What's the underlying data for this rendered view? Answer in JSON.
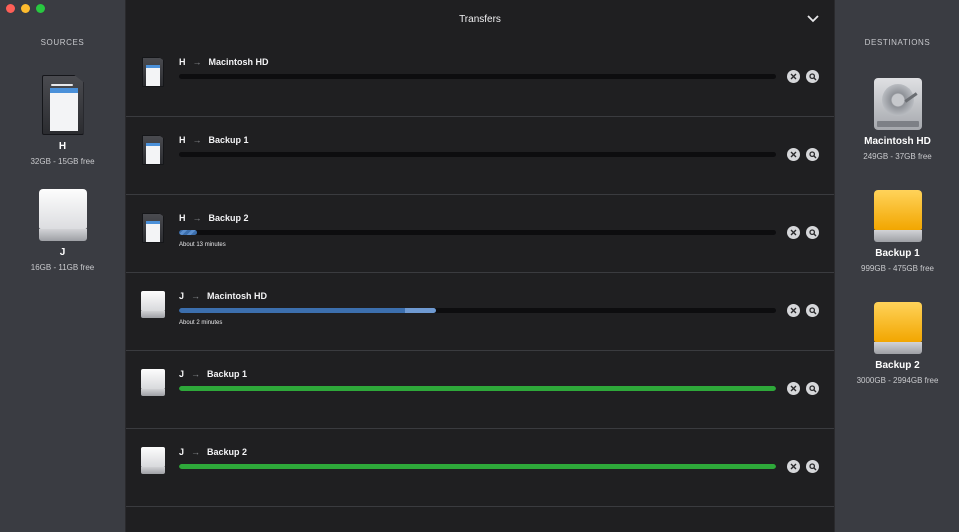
{
  "window": {
    "title": "Transfers"
  },
  "sources": {
    "title": "SOURCES",
    "items": [
      {
        "name": "H",
        "size": "32GB - 15GB free",
        "icon": "sd-card-icon"
      },
      {
        "name": "J",
        "size": "16GB - 11GB free",
        "icon": "external-disk-icon"
      }
    ]
  },
  "destinations": {
    "title": "DESTINATIONS",
    "items": [
      {
        "name": "Macintosh HD",
        "size": "249GB - 37GB free",
        "icon": "internal-hdd-icon"
      },
      {
        "name": "Backup 1",
        "size": "999GB - 475GB free",
        "icon": "yellow-disk-icon"
      },
      {
        "name": "Backup 2",
        "size": "3000GB - 2994GB free",
        "icon": "yellow-disk-icon"
      }
    ]
  },
  "transfers": [
    {
      "source": "H",
      "destination": "Macintosh HD",
      "progress": 0.0,
      "state": "queued",
      "eta": ""
    },
    {
      "source": "H",
      "destination": "Backup 1",
      "progress": 0.0,
      "state": "queued",
      "eta": ""
    },
    {
      "source": "H",
      "destination": "Backup 2",
      "progress": 0.03,
      "state": "in-progress",
      "eta": "About 13 minutes"
    },
    {
      "source": "J",
      "destination": "Macintosh HD",
      "progress": 0.43,
      "state": "in-progress",
      "eta": "About 2 minutes"
    },
    {
      "source": "J",
      "destination": "Backup 1",
      "progress": 1.0,
      "state": "complete",
      "eta": ""
    },
    {
      "source": "J",
      "destination": "Backup 2",
      "progress": 1.0,
      "state": "complete",
      "eta": ""
    }
  ],
  "colors": {
    "progress_active": "#3c6fae",
    "progress_complete": "#2ea83a",
    "sidebar": "#3a3c42",
    "main": "#1f1f21"
  }
}
